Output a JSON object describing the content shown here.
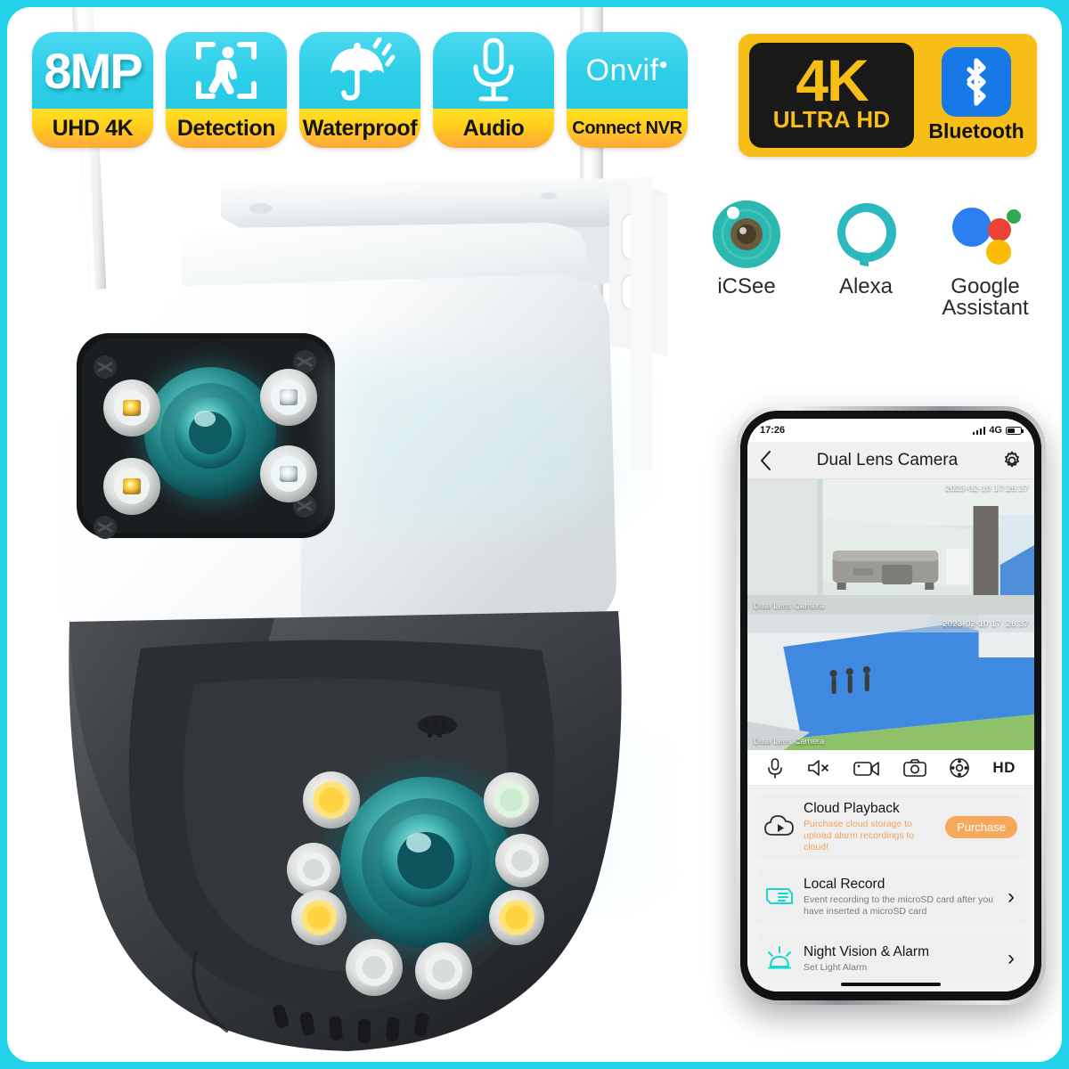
{
  "theme": {
    "frame_color": "#22D3E8",
    "badge_cyan": "#2ECFE8",
    "badge_yellow": "#FFD11A",
    "accent_yellow": "#F7BE18",
    "bluetooth_blue": "#1778E8",
    "app_teal": "#17D6CF",
    "purchase_orange": "#F6A85C"
  },
  "feature_badges": [
    {
      "id": "resolution",
      "top_text": "8MP",
      "bottom_text": "UHD 4K",
      "icon": "none"
    },
    {
      "id": "detection",
      "top_text": "",
      "bottom_text": "Detection",
      "icon": "human-detection-icon"
    },
    {
      "id": "waterproof",
      "top_text": "",
      "bottom_text": "Waterproof",
      "icon": "umbrella-rain-icon"
    },
    {
      "id": "audio",
      "top_text": "",
      "bottom_text": "Audio",
      "icon": "microphone-icon"
    },
    {
      "id": "onvif",
      "top_text": "Onvif",
      "bottom_text": "Connect NVR",
      "icon": "none"
    }
  ],
  "resolution_badge": {
    "main": "4K",
    "sub": "ULTRA HD",
    "bluetooth_label": "Bluetooth"
  },
  "ecosystem": [
    {
      "id": "icsee",
      "label": "iCSee",
      "icon": "icsee-eye-icon"
    },
    {
      "id": "alexa",
      "label": "Alexa",
      "icon": "alexa-ring-icon"
    },
    {
      "id": "google",
      "label": "Google Assistant",
      "label_line1": "Google",
      "label_line2": "Assistant",
      "icon": "google-assistant-dots-icon"
    }
  ],
  "phone": {
    "status_bar": {
      "time": "17:26",
      "network": "4G"
    },
    "app_bar": {
      "title": "Dual Lens Camera",
      "back_icon": "chevron-left-icon",
      "settings_icon": "gear-icon"
    },
    "feeds": [
      {
        "timestamp": "2023-02-10 17:26:37",
        "label": "Dual Lens Camera",
        "scene": "indoor-hallway"
      },
      {
        "timestamp": "2023-02-10 17 :26:37",
        "label": "Dual Lens Camera",
        "scene": "outdoor-lawn"
      }
    ],
    "toolbar": [
      {
        "id": "mic",
        "icon": "microphone-icon",
        "label": ""
      },
      {
        "id": "speaker",
        "icon": "speaker-mute-icon",
        "label": ""
      },
      {
        "id": "record",
        "icon": "video-camera-icon",
        "label": ""
      },
      {
        "id": "snapshot",
        "icon": "camera-icon",
        "label": ""
      },
      {
        "id": "ptz",
        "icon": "ptz-dpad-icon",
        "label": ""
      },
      {
        "id": "quality",
        "icon": "none",
        "label": "HD"
      }
    ],
    "rows": [
      {
        "id": "cloud-playback",
        "icon": "cloud-play-icon",
        "title": "Cloud Playback",
        "subtitle": "Purchase cloud storage to upload alarm recordings to cloud!",
        "action_label": "Purchase",
        "action_type": "button"
      },
      {
        "id": "local-record",
        "icon": "sd-card-icon",
        "title": "Local Record",
        "subtitle": "Event recording to the microSD card after you have inserted a microSD card",
        "action_label": "›",
        "action_type": "chevron"
      },
      {
        "id": "night-vision-alarm",
        "icon": "alarm-light-icon",
        "title": "Night Vision & Alarm",
        "subtitle": "Set Light Alarm",
        "action_label": "›",
        "action_type": "chevron"
      }
    ]
  },
  "product": {
    "name": "Dual Lens PTZ WiFi Camera",
    "antennas": 2,
    "top_module": {
      "leds": 4,
      "lens": 1,
      "screws": 4
    },
    "ptz_dome": {
      "leds": 8,
      "lens": 1
    }
  }
}
